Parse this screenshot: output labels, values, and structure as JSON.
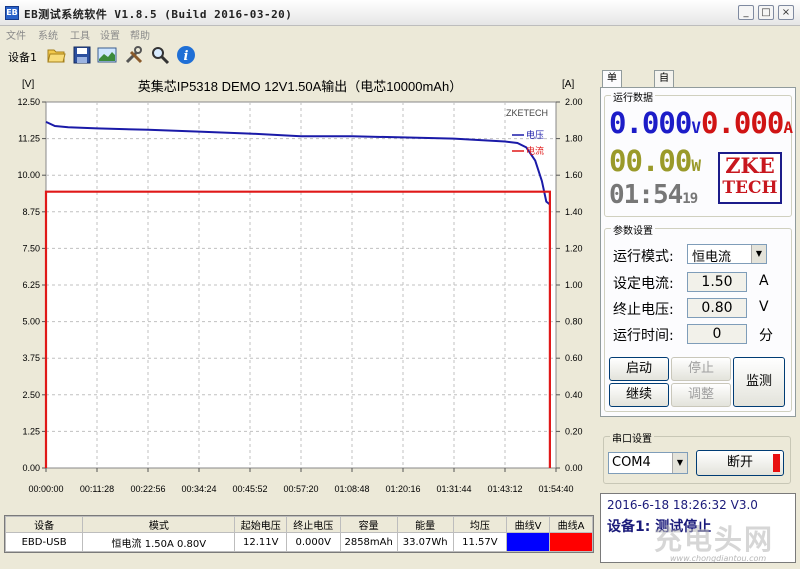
{
  "window": {
    "title": "EB测试系统软件 V1.8.5 (Build 2016-03-20)",
    "app_icon": "eb-app-icon",
    "controls": {
      "minimize": "_",
      "maximize": "□",
      "close": "×"
    }
  },
  "menu": [
    "文件",
    "系统",
    "工具",
    "设置",
    "帮助"
  ],
  "toolbar": {
    "device_label": "设备1",
    "icons": [
      "open-folder-icon",
      "save-icon",
      "chart-image-icon",
      "tools-icon",
      "search-icon",
      "info-icon"
    ]
  },
  "chart_data": {
    "type": "line",
    "title": "英集芯IP5318 DEMO 12V1.50A输出（电芯10000mAh）",
    "left_unit": "[V]",
    "right_unit": "[A]",
    "y_left_ticks": [
      "12.50",
      "11.25",
      "10.00",
      "8.75",
      "7.50",
      "6.25",
      "5.00",
      "3.75",
      "2.50",
      "1.25",
      "0.00"
    ],
    "y_right_ticks": [
      "2.00",
      "1.80",
      "1.60",
      "1.40",
      "1.20",
      "1.00",
      "0.80",
      "0.60",
      "0.40",
      "0.20",
      "0.00"
    ],
    "x_ticks": [
      "00:00:00",
      "00:11:28",
      "00:22:56",
      "00:34:24",
      "00:45:52",
      "00:57:20",
      "01:08:48",
      "01:20:16",
      "01:31:44",
      "01:43:12",
      "01:54:40"
    ],
    "ylim_left": [
      0,
      12.5
    ],
    "ylim_right": [
      0,
      2.0
    ],
    "grid": true,
    "watermark": "ZKETECH",
    "legend_position": "top-right",
    "series": [
      {
        "name": "电压",
        "color": "#1a1aa8",
        "axis": "left",
        "points": [
          [
            0,
            11.82
          ],
          [
            2,
            11.68
          ],
          [
            5,
            11.64
          ],
          [
            11.5,
            11.6
          ],
          [
            23,
            11.55
          ],
          [
            34.4,
            11.49
          ],
          [
            45.9,
            11.42
          ],
          [
            57.3,
            11.33
          ],
          [
            68.8,
            11.33
          ],
          [
            80.3,
            11.29
          ],
          [
            91.7,
            11.25
          ],
          [
            103.2,
            11.15
          ],
          [
            106,
            11.1
          ],
          [
            108,
            10.95
          ],
          [
            110,
            10.5
          ],
          [
            111.5,
            9.8
          ],
          [
            112.5,
            9.1
          ],
          [
            113.3,
            9.0
          ]
        ]
      },
      {
        "name": "电流",
        "color": "#e01818",
        "axis": "right",
        "points": [
          [
            0,
            0
          ],
          [
            0,
            1.51
          ],
          [
            113.3,
            1.51
          ],
          [
            113.3,
            0
          ]
        ]
      }
    ]
  },
  "bottom_table": {
    "headers": [
      "设备",
      "模式",
      "起始电压",
      "终止电压",
      "容量",
      "能量",
      "均压",
      "曲线V",
      "曲线A"
    ],
    "row": [
      "EBD-USB",
      "恒电流 1.50A 0.80V",
      "12.11V",
      "0.000V",
      "2858mAh",
      "33.07Wh",
      "11.57V"
    ],
    "curve_v_color": "#0000ff",
    "curve_a_color": "#ff0000"
  },
  "tabs": [
    "单次测试",
    "自动测试"
  ],
  "run_data": {
    "label": "运行数据",
    "voltage": "0.000",
    "voltage_unit": "V",
    "current": "0.000",
    "current_unit": "A",
    "power": "00.00",
    "power_unit": "W",
    "time_main": "01:54",
    "time_sec": "19",
    "logo_line1": "ZKE",
    "logo_line2": "TECH"
  },
  "params": {
    "label": "参数设置",
    "mode_label": "运行模式:",
    "mode_value": "恒电流",
    "current_label": "设定电流:",
    "current_value": "1.50",
    "current_unit": "A",
    "cutoff_label": "终止电压:",
    "cutoff_value": "0.80",
    "cutoff_unit": "V",
    "runtime_label": "运行时间:",
    "runtime_value": "0",
    "runtime_unit": "分"
  },
  "buttons": {
    "start": "启动",
    "stop": "停止",
    "continue": "继续",
    "adjust": "调整",
    "monitor": "监测"
  },
  "serial": {
    "label": "串口设置",
    "port": "COM4",
    "disconnect": "断开",
    "indicator_color": "#e81010"
  },
  "status": {
    "datetime": "2016-6-18 18:26:32",
    "version_frag": "V3.0",
    "device_status": "设备1: 测试停止"
  },
  "watermark": {
    "brand": "充电头网",
    "url": "www.chongdiantou.com"
  }
}
